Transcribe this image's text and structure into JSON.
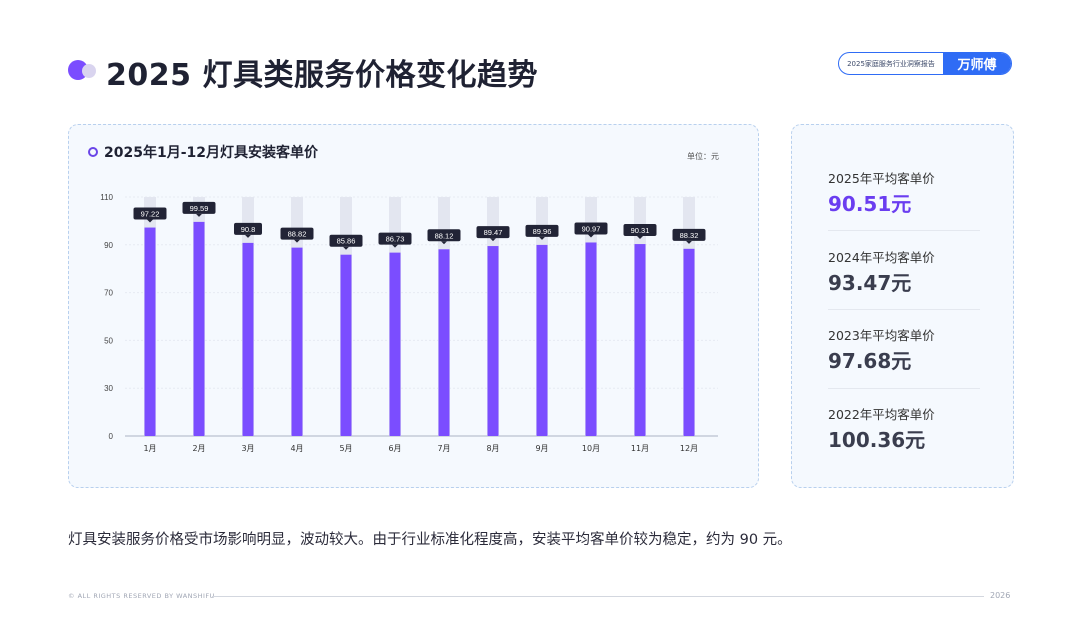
{
  "header": {
    "title": "2025 灯具类服务价格变化趋势",
    "brand_report": "2025家庭服务行业洞察报告",
    "brand_name": "万师傅"
  },
  "chart_card": {
    "title": "2025年1月-12月灯具安装客单价",
    "unit": "单位：元"
  },
  "chart_data": {
    "type": "bar",
    "title": "2025年1月-12月灯具安装客单价",
    "categories": [
      "1月",
      "2月",
      "3月",
      "4月",
      "5月",
      "6月",
      "7月",
      "8月",
      "9月",
      "10月",
      "11月",
      "12月"
    ],
    "values": [
      97.22,
      99.59,
      90.8,
      88.82,
      85.86,
      86.73,
      88.12,
      89.47,
      89.96,
      90.97,
      90.31,
      88.32
    ],
    "data_labels": [
      "97.22",
      "99.59",
      "90.8",
      "88.82",
      "85.86",
      "86.73",
      "88.12",
      "89.47",
      "89.96",
      "90.97",
      "90.31",
      "88.32"
    ],
    "background_max": 110,
    "yticks": [
      0,
      30,
      50,
      70,
      90,
      110
    ],
    "ylim": [
      0,
      110
    ],
    "colors": {
      "bar": "#7b4dff",
      "track": "#e3e6f0",
      "label_bg": "#222436",
      "label_text": "#ffffff"
    },
    "grid": true
  },
  "stats": [
    {
      "label": "2025年平均客单价",
      "value": "90.51元",
      "highlight": true
    },
    {
      "label": "2024年平均客单价",
      "value": "93.47元",
      "highlight": false
    },
    {
      "label": "2023年平均客单价",
      "value": "97.68元",
      "highlight": false
    },
    {
      "label": "2022年平均客单价",
      "value": "100.36元",
      "highlight": false
    }
  ],
  "summary": "灯具安装服务价格受市场影响明显，波动较大。由于行业标准化程度高，安装平均客单价较为稳定，约为 90 元。",
  "footer": {
    "copyright": "© ALL RIGHTS RESERVED BY WANSHIFU",
    "year": "2026"
  }
}
